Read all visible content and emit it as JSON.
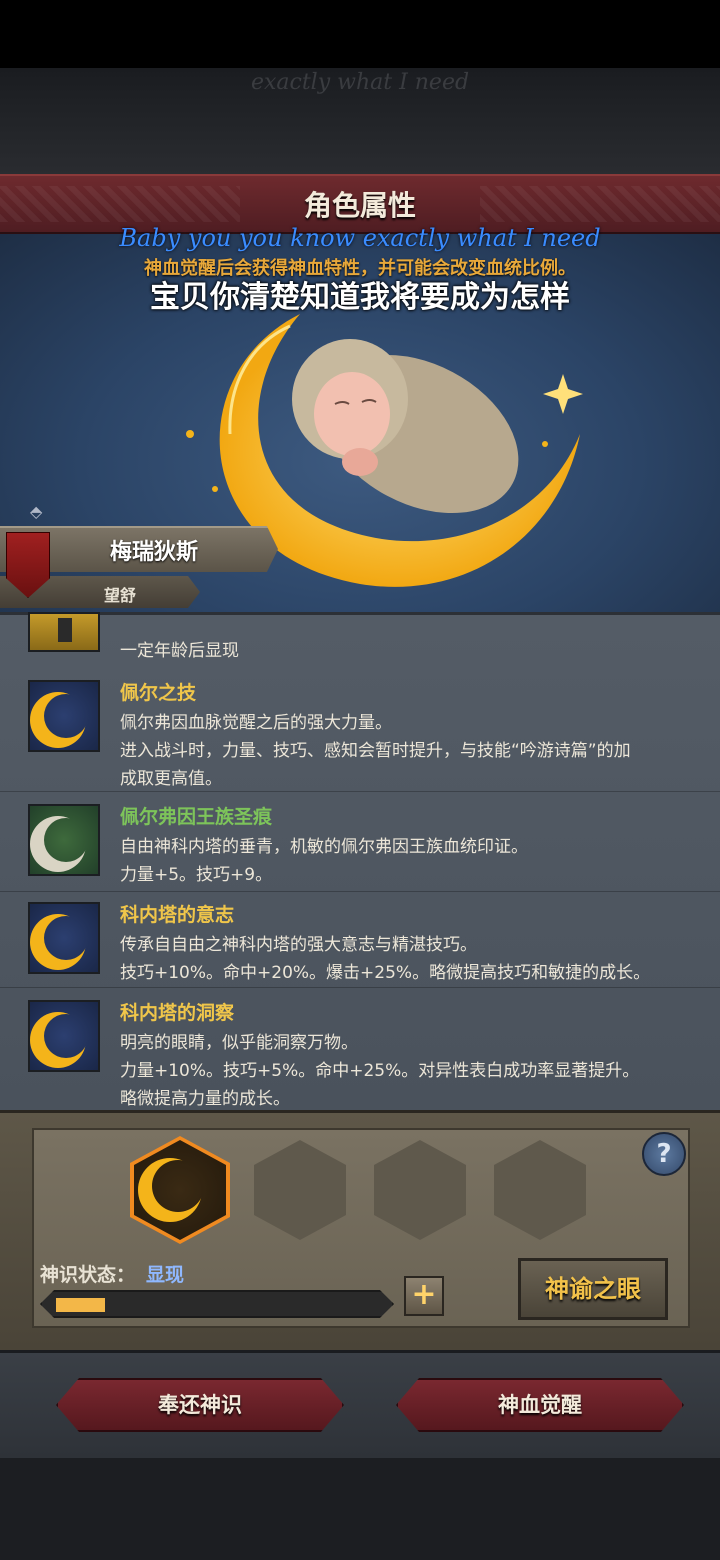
{
  "lyrics": {
    "faint_top": "exactly what I need",
    "english": "Baby you you know exactly what I need",
    "chinese": "宝贝你清楚知道我将要成为怎样"
  },
  "header": {
    "title": "角色属性"
  },
  "hero": {
    "description": "神血觉醒后会获得神血特性，并可能会改变血统比例。",
    "character_name": "梅瑞狄斯",
    "character_subtitle": "望舒"
  },
  "traits": {
    "partial_line": "一定年龄后显现",
    "items": [
      {
        "icon": "crescent-moon-icon",
        "title": "佩尔之技",
        "lines": [
          "佩尔弗因血脉觉醒之后的强大力量。",
          "进入战斗时，力量、技巧、感知会暂时提升，与技能“吟游诗篇”的加",
          "成取更高值。"
        ]
      },
      {
        "icon": "silver-moon-icon",
        "title": "佩尔弗因王族圣痕",
        "lines": [
          "自由神科内塔的垂青，机敏的佩尔弗因王族血统印证。",
          "力量+5。技巧+9。"
        ]
      },
      {
        "icon": "crescent-moon-icon",
        "title": "科内塔的意志",
        "lines": [
          "传承自自由之神科内塔的强大意志与精湛技巧。",
          "技巧+10%。命中+20%。爆击+25%。略微提高技巧和敏捷的成长。"
        ]
      },
      {
        "icon": "crescent-moon-icon",
        "title": "科内塔的洞察",
        "lines": [
          "明亮的眼睛，似乎能洞察万物。",
          "力量+10%。技巧+5%。命中+25%。对异性表白成功率显著提升。",
          "略微提高力量的成长。"
        ]
      }
    ]
  },
  "divine": {
    "state_label": "神识状态：",
    "state_value": "显现",
    "progress": 0.15,
    "plus_label": "+",
    "help_label": "?",
    "oracle_button": "神谕之眼"
  },
  "footer": {
    "return_button": "奉还神识",
    "awaken_button": "神血觉醒"
  },
  "colors": {
    "title_red": "#6e2a2e",
    "gold": "#f4b41a",
    "trait_title": "#f0c64a",
    "trait_title_green": "#7dc45a",
    "state_blue": "#8fb8ff"
  }
}
